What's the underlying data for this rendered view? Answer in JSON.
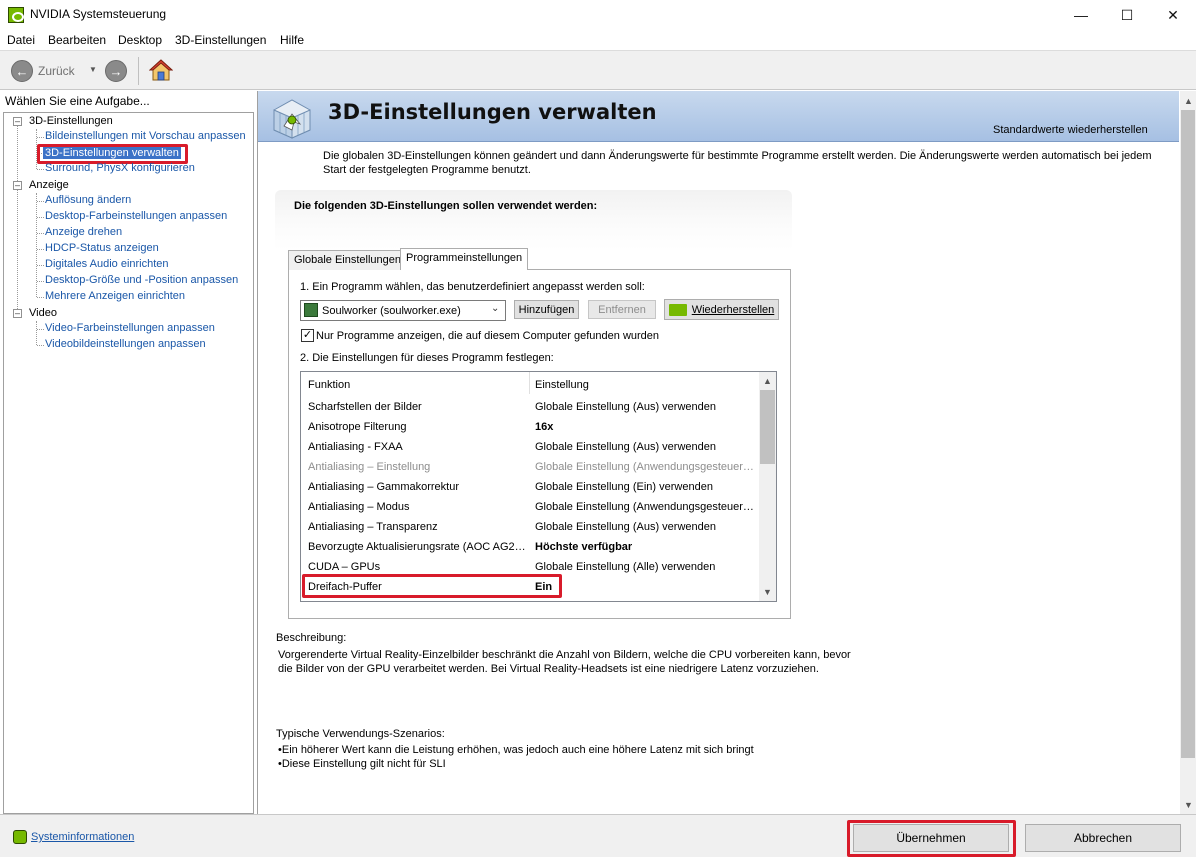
{
  "window": {
    "title": "NVIDIA Systemsteuerung"
  },
  "menu": [
    "Datei",
    "Bearbeiten",
    "Desktop",
    "3D-Einstellungen",
    "Hilfe"
  ],
  "toolbar": {
    "back_label": "Zurück"
  },
  "task_panel": {
    "header": "Wählen Sie eine Aufgabe...",
    "tree": [
      {
        "label": "3D-Einstellungen",
        "items": [
          "Bildeinstellungen mit Vorschau anpassen",
          "3D-Einstellungen verwalten",
          "Surround, PhysX konfigurieren"
        ]
      },
      {
        "label": "Anzeige",
        "items": [
          "Auflösung ändern",
          "Desktop-Farbeinstellungen anpassen",
          "Anzeige drehen",
          "HDCP-Status anzeigen",
          "Digitales Audio einrichten",
          "Desktop-Größe und -Position anpassen",
          "Mehrere Anzeigen einrichten"
        ]
      },
      {
        "label": "Video",
        "items": [
          "Video-Farbeinstellungen anpassen",
          "Videobildeinstellungen anpassen"
        ]
      }
    ],
    "selected": "3D-Einstellungen verwalten"
  },
  "page": {
    "title": "3D-Einstellungen verwalten",
    "restore_defaults": "Standardwerte wiederherstellen",
    "intro": "Die globalen 3D-Einstellungen können geändert und dann Änderungswerte für bestimmte Programme erstellt werden. Die Änderungswerte werden automatisch bei jedem Start der festgelegten Programme benutzt.",
    "settings_heading": "Die folgenden 3D-Einstellungen sollen verwendet werden:",
    "tabs": [
      "Globale Einstellungen",
      "Programmeinstellungen"
    ],
    "active_tab": "Programmeinstellungen",
    "step1": "1. Ein Programm wählen, das benutzerdefiniert angepasst werden soll:",
    "program_selected": "Soulworker (soulworker.exe)",
    "buttons": {
      "add": "Hinzufügen",
      "remove": "Entfernen",
      "restore": "Wiederherstellen"
    },
    "checkbox_label": "Nur Programme anzeigen, die auf diesem Computer gefunden wurden",
    "checkbox_checked": true,
    "step2": "2. Die Einstellungen für dieses Programm festlegen:",
    "columns": [
      "Funktion",
      "Einstellung"
    ],
    "rows": [
      {
        "function": "Scharfstellen der Bilder",
        "value": "Globale Einstellung (Aus) verwenden",
        "style": "normal"
      },
      {
        "function": "Anisotrope Filterung",
        "value": "16x",
        "style": "bold"
      },
      {
        "function": "Antialiasing - FXAA",
        "value": "Globale Einstellung (Aus) verwenden",
        "style": "normal"
      },
      {
        "function": "Antialiasing – Einstellung",
        "value": "Globale Einstellung (Anwendungsgesteuer…",
        "style": "grey"
      },
      {
        "function": "Antialiasing – Gammakorrektur",
        "value": "Globale Einstellung (Ein) verwenden",
        "style": "normal"
      },
      {
        "function": "Antialiasing – Modus",
        "value": "Globale Einstellung (Anwendungsgesteuer…",
        "style": "normal"
      },
      {
        "function": "Antialiasing – Transparenz",
        "value": "Globale Einstellung (Aus) verwenden",
        "style": "normal"
      },
      {
        "function": "Bevorzugte Aktualisierungsrate (AOC AG2…",
        "value": "Höchste verfügbar",
        "style": "bold"
      },
      {
        "function": "CUDA – GPUs",
        "value": "Globale Einstellung (Alle) verwenden",
        "style": "normal"
      },
      {
        "function": "Dreifach-Puffer",
        "value": "Ein",
        "style": "bold"
      }
    ],
    "description_label": "Beschreibung:",
    "description": "Vorgerenderte Virtual Reality-Einzelbilder beschränkt die Anzahl von Bildern, welche die CPU vorbereiten kann, bevor die Bilder von der GPU verarbeitet werden. Bei Virtual Reality-Headsets ist eine niedrigere Latenz vorzuziehen.",
    "usage_label": "Typische Verwendungs-Szenarios:",
    "usage": [
      "Ein höherer Wert kann die Leistung erhöhen, was jedoch auch eine höhere Latenz mit sich bringt",
      "Diese Einstellung gilt nicht für SLI"
    ]
  },
  "footer": {
    "sysinfo": "Systeminformationen",
    "apply": "Übernehmen",
    "cancel": "Abbrechen"
  },
  "colors": {
    "highlight_red": "#d81b2a",
    "nvidia_green": "#76b900",
    "link_blue": "#1a57a8",
    "selection_blue": "#3c72c7"
  }
}
